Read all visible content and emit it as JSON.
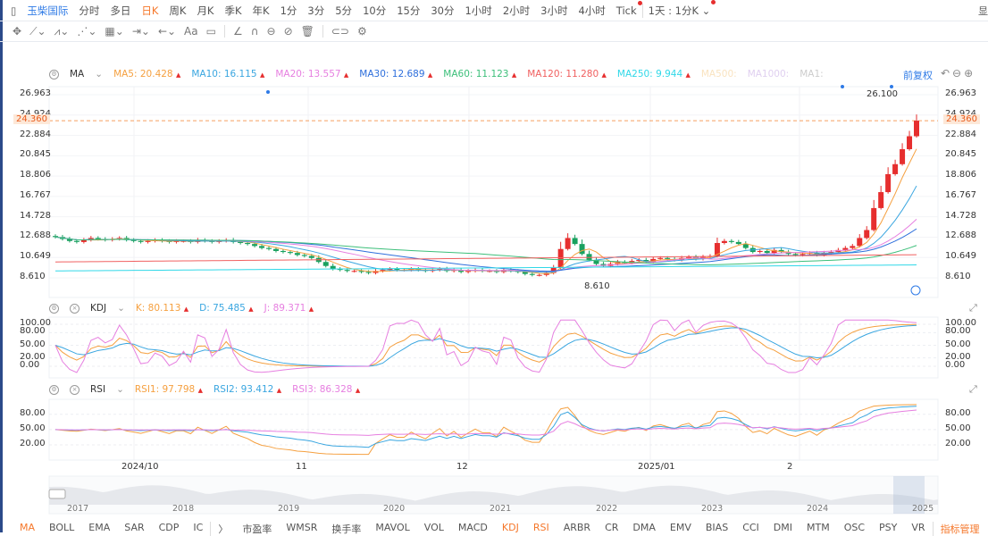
{
  "top": {
    "name": "玉柴国际",
    "periods": [
      "分时",
      "多日",
      "日K",
      "周K",
      "月K",
      "季K",
      "年K",
      "1分",
      "3分",
      "5分",
      "10分",
      "15分",
      "30分",
      "1小时",
      "2小时",
      "3小时",
      "4小时",
      "Tick"
    ],
    "active": "日K",
    "combo": "1天 : 1分K",
    "right_cut": "显"
  },
  "tools": [
    "move-icon",
    "line-icon",
    "polyline-icon",
    "wave-icon",
    "fib-icon",
    "range-icon",
    "arrow-icon",
    "text-icon",
    "note-icon",
    "angle-icon",
    "magnet-icon",
    "lock-icon",
    "hide-icon",
    "delete-icon",
    "compare-icon",
    "settings-icon"
  ],
  "ma_legend": {
    "title": "MA",
    "items": [
      {
        "label": "MA5:",
        "value": "20.428",
        "color": "#f5a040"
      },
      {
        "label": "MA10:",
        "value": "16.115",
        "color": "#3aa6e0"
      },
      {
        "label": "MA20:",
        "value": "13.557",
        "color": "#e67fe0"
      },
      {
        "label": "MA30:",
        "value": "12.689",
        "color": "#2e6fdc"
      },
      {
        "label": "MA60:",
        "value": "11.123",
        "color": "#3cbf7a"
      },
      {
        "label": "MA120:",
        "value": "11.280",
        "color": "#f06060"
      },
      {
        "label": "MA250:",
        "value": "9.944",
        "color": "#30d8e8"
      },
      {
        "label": "MA500:",
        "value": "",
        "color": "#f9e3c0"
      },
      {
        "label": "MA1000:",
        "value": "",
        "color": "#e0d0f0"
      },
      {
        "label": "MA1:",
        "value": "",
        "color": "#cccccc"
      }
    ],
    "adjust": "前复权"
  },
  "kdj_legend": {
    "title": "KDJ",
    "items": [
      {
        "label": "K:",
        "value": "80.113",
        "color": "#f5a040"
      },
      {
        "label": "D:",
        "value": "75.485",
        "color": "#3aa6e0"
      },
      {
        "label": "J:",
        "value": "89.371",
        "color": "#e67fe0"
      }
    ]
  },
  "rsi_legend": {
    "title": "RSI",
    "items": [
      {
        "label": "RSI1:",
        "value": "97.798",
        "color": "#f5a040"
      },
      {
        "label": "RSI2:",
        "value": "93.412",
        "color": "#3aa6e0"
      },
      {
        "label": "RSI3:",
        "value": "86.328",
        "color": "#e67fe0"
      }
    ]
  },
  "chart_data": {
    "type": "candlestick",
    "price_ticks": [
      "26.963",
      "24.924",
      "22.884",
      "20.845",
      "18.806",
      "16.767",
      "14.728",
      "12.688",
      "10.649",
      "8.610"
    ],
    "ylim": [
      8.61,
      26.963
    ],
    "last_price": "24.360",
    "high_label": "26.100",
    "low_label": "8.610",
    "kdj_ticks": [
      "100.00",
      "80.00",
      "50.00",
      "20.00",
      "0.00"
    ],
    "rsi_ticks": [
      "80.00",
      "50.00",
      "20.00"
    ],
    "time_labels": [
      "2024/10",
      "11",
      "12",
      "2025/01",
      "2"
    ],
    "navigator_years": [
      "2017",
      "2018",
      "2019",
      "2020",
      "2021",
      "2022",
      "2023",
      "2024",
      "2025"
    ],
    "closes": [
      12.7,
      12.5,
      12.3,
      12.2,
      12.4,
      12.6,
      12.5,
      12.4,
      12.5,
      12.6,
      12.4,
      12.3,
      12.2,
      12.3,
      12.4,
      12.3,
      12.2,
      12.3,
      12.3,
      12.2,
      12.4,
      12.3,
      12.2,
      12.3,
      12.4,
      12.2,
      12.1,
      12.0,
      11.8,
      11.6,
      11.5,
      11.3,
      11.2,
      11.1,
      10.9,
      10.8,
      10.6,
      10.2,
      9.8,
      9.5,
      9.4,
      9.3,
      9.3,
      9.2,
      9.1,
      9.3,
      9.4,
      9.5,
      9.4,
      9.4,
      9.5,
      9.4,
      9.3,
      9.4,
      9.5,
      9.3,
      9.4,
      9.2,
      9.3,
      9.4,
      9.3,
      9.3,
      9.2,
      9.4,
      9.3,
      9.2,
      9.0,
      8.9,
      8.9,
      9.1,
      9.6,
      11.5,
      12.6,
      12.0,
      11.0,
      10.4,
      10.0,
      9.8,
      10.0,
      10.2,
      10.1,
      10.3,
      10.4,
      10.2,
      10.5,
      10.6,
      10.5,
      10.4,
      10.6,
      10.7,
      10.5,
      10.7,
      10.8,
      12.1,
      12.3,
      12.2,
      12.0,
      11.6,
      11.2,
      11.3,
      11.1,
      11.4,
      11.2,
      11.0,
      10.9,
      11.0,
      11.1,
      10.9,
      11.1,
      11.2,
      11.4,
      11.6,
      11.8,
      12.6,
      13.4,
      15.6,
      17.2,
      19.0,
      20.0,
      21.5,
      22.8,
      24.36
    ]
  },
  "bottom_tabs": [
    "MA",
    "BOLL",
    "EMA",
    "SAR",
    "CDP",
    "IC",
    "〉",
    "市盈率",
    "WMSR",
    "换手率",
    "MAVOL",
    "VOL",
    "MACD",
    "KDJ",
    "RSI",
    "ARBR",
    "CR",
    "DMA",
    "EMV",
    "BIAS",
    "CCI",
    "DMI",
    "MTM",
    "OSC",
    "PSY",
    "VR",
    "指标管理"
  ],
  "bottom_active": [
    "MA",
    "KDJ",
    "RSI",
    "指标管理"
  ],
  "colors": {
    "up": "#e62e2e",
    "down": "#19a15f"
  }
}
